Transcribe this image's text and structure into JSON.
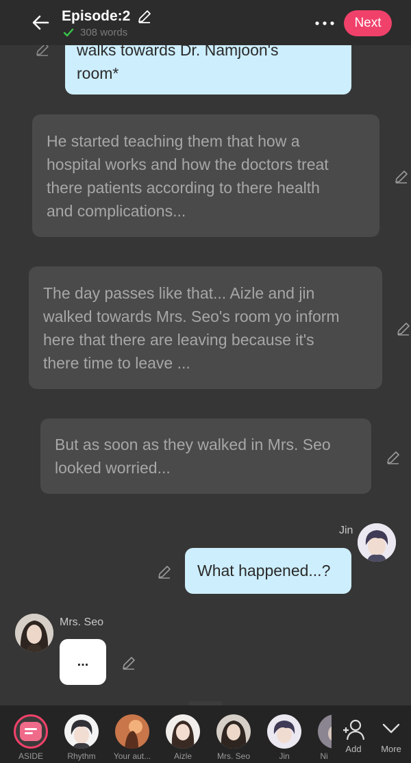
{
  "header": {
    "title": "Episode:2",
    "word_count": "308 words",
    "next_label": "Next"
  },
  "messages": {
    "m1": "walks towards Dr. Namjoon's room*",
    "m1_line1": "walks towards Dr. Namjoon's",
    "m1_line2": "room*",
    "m2_lines": [
      "He started teaching them that how a",
      "hospital works and how the doctors treat",
      "there patients according to there health",
      "and complications..."
    ],
    "m3_lines": [
      "The day passes like that... Aizle and jin",
      "walked towards Mrs. Seo's room yo inform",
      "here that there are leaving because it's",
      "there time to leave ..."
    ],
    "m4_lines": [
      "But as soon as they walked in Mrs. Seo",
      "looked worried..."
    ],
    "m5_speaker": "Jin",
    "m5": "What happened...?",
    "m6_speaker": "Mrs. Seo",
    "m6": "..."
  },
  "cast": [
    {
      "label": "ASIDE",
      "icon": "aside-icon"
    },
    {
      "label": "Rhythm",
      "icon": "avatar"
    },
    {
      "label": "Your aut...",
      "icon": "avatar"
    },
    {
      "label": "Aizle",
      "icon": "avatar"
    },
    {
      "label": "Mrs. Seo",
      "icon": "avatar"
    },
    {
      "label": "Jin",
      "icon": "avatar"
    },
    {
      "label": "Ni",
      "icon": "avatar"
    }
  ],
  "actions": {
    "add_label": "Add",
    "more_label": "More"
  },
  "colors": {
    "accent": "#f0416a",
    "background": "#363636",
    "bubble_blue": "#cdeefd",
    "bubble_gray": "#4a4a4a"
  }
}
